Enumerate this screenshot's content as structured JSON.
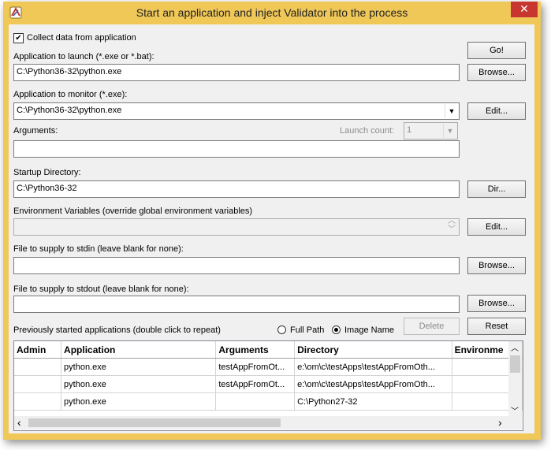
{
  "window": {
    "title": "Start an application and inject Validator into the process",
    "close_glyph": "✕"
  },
  "collect": {
    "label": "Collect data from application",
    "checked_glyph": "✔"
  },
  "launch": {
    "label": "Application to launch (*.exe or *.bat):",
    "value": "C:\\Python36-32\\python.exe"
  },
  "monitor": {
    "label": "Application to monitor (*.exe):",
    "value": "C:\\Python36-32\\python.exe",
    "arrow": "▼"
  },
  "arguments": {
    "label": "Arguments:",
    "value": ""
  },
  "launch_count": {
    "label": "Launch count:",
    "value": "1",
    "arrow": "▼"
  },
  "startup": {
    "label": "Startup Directory:",
    "value": "C:\\Python36-32"
  },
  "env": {
    "label": "Environment Variables (override global environment variables)",
    "up": "︿",
    "down": "﹀"
  },
  "stdin": {
    "label": "File to supply to stdin (leave blank for none):",
    "value": ""
  },
  "stdout": {
    "label": "File to supply to stdout (leave blank for none):",
    "value": ""
  },
  "history": {
    "label": "Previously started applications (double click to repeat)",
    "full_path": "Full Path",
    "image_name": "Image Name",
    "columns": [
      "Admin",
      "Application",
      "Arguments",
      "Directory",
      "Environme"
    ],
    "rows": [
      [
        "",
        "python.exe",
        "testAppFromOt...",
        "e:\\om\\c\\testApps\\testAppFromOth...",
        ""
      ],
      [
        "",
        "python.exe",
        "testAppFromOt...",
        "e:\\om\\c\\testApps\\testAppFromOth...",
        ""
      ],
      [
        "",
        "python.exe",
        "",
        "C:\\Python27-32",
        ""
      ]
    ]
  },
  "buttons": {
    "go": "Go!",
    "browse_launch": "Browse...",
    "edit_monitor": "Edit...",
    "dir": "Dir...",
    "edit_env": "Edit...",
    "browse_stdin": "Browse...",
    "browse_stdout": "Browse...",
    "delete": "Delete",
    "reset": "Reset"
  },
  "scroll": {
    "up": "︿",
    "down": "﹀",
    "left": "‹",
    "right": "›"
  },
  "colors": {
    "frame": "#f0c858",
    "close": "#c7372f",
    "client": "#f0f0f0"
  }
}
